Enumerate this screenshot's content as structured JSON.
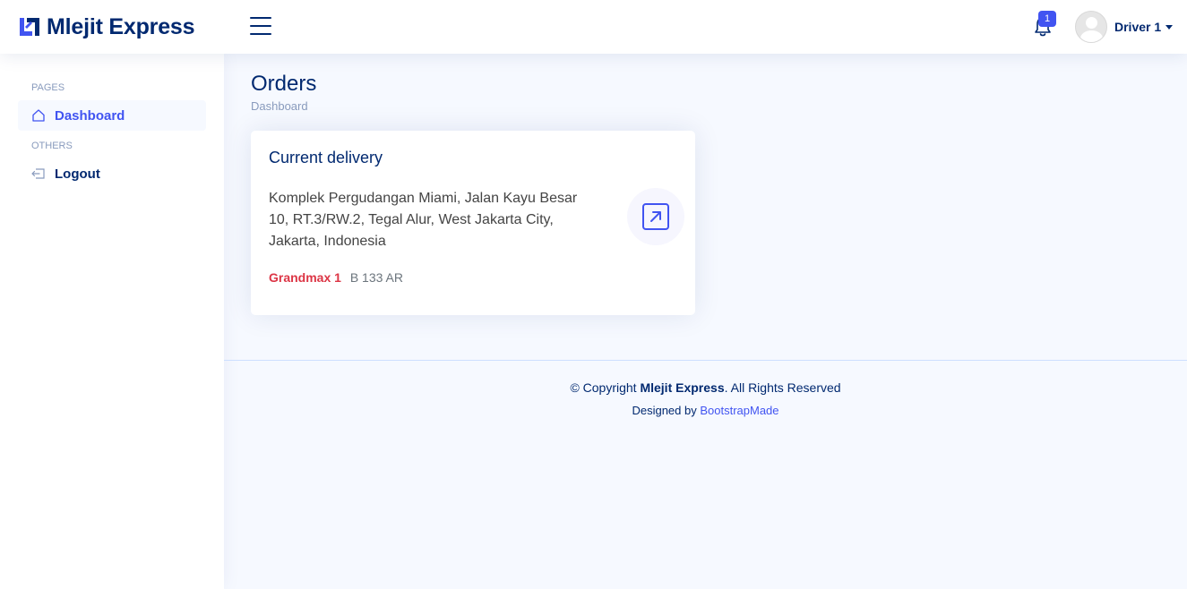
{
  "header": {
    "brand": "Mlejit Express",
    "notification_count": "1",
    "user_name": "Driver 1"
  },
  "sidebar": {
    "heading_pages": "PAGES",
    "heading_others": "OTHERS",
    "items": [
      {
        "label": "Dashboard",
        "icon": "house-icon",
        "active": true
      },
      {
        "label": "Logout",
        "icon": "logout-icon",
        "active": false
      }
    ]
  },
  "main": {
    "title": "Orders",
    "breadcrumb": "Dashboard",
    "card": {
      "title": "Current delivery",
      "address": "Komplek Pergudangan Miami, Jalan Kayu Besar 10, RT.3/RW.2, Tegal Alur, West Jakarta City, Jakarta, Indonesia",
      "vehicle": "Grandmax 1",
      "plate": "B 133 AR"
    }
  },
  "footer": {
    "copyright_prefix": "© Copyright",
    "copyright_brand": "Mlejit Express",
    "copyright_suffix": ". All Rights Reserved",
    "designed_by": "Designed by",
    "designer": "BootstrapMade"
  },
  "colors": {
    "primary": "#4154f1",
    "navy": "#012970",
    "danger": "#dc3545",
    "background": "#f6f9ff"
  }
}
